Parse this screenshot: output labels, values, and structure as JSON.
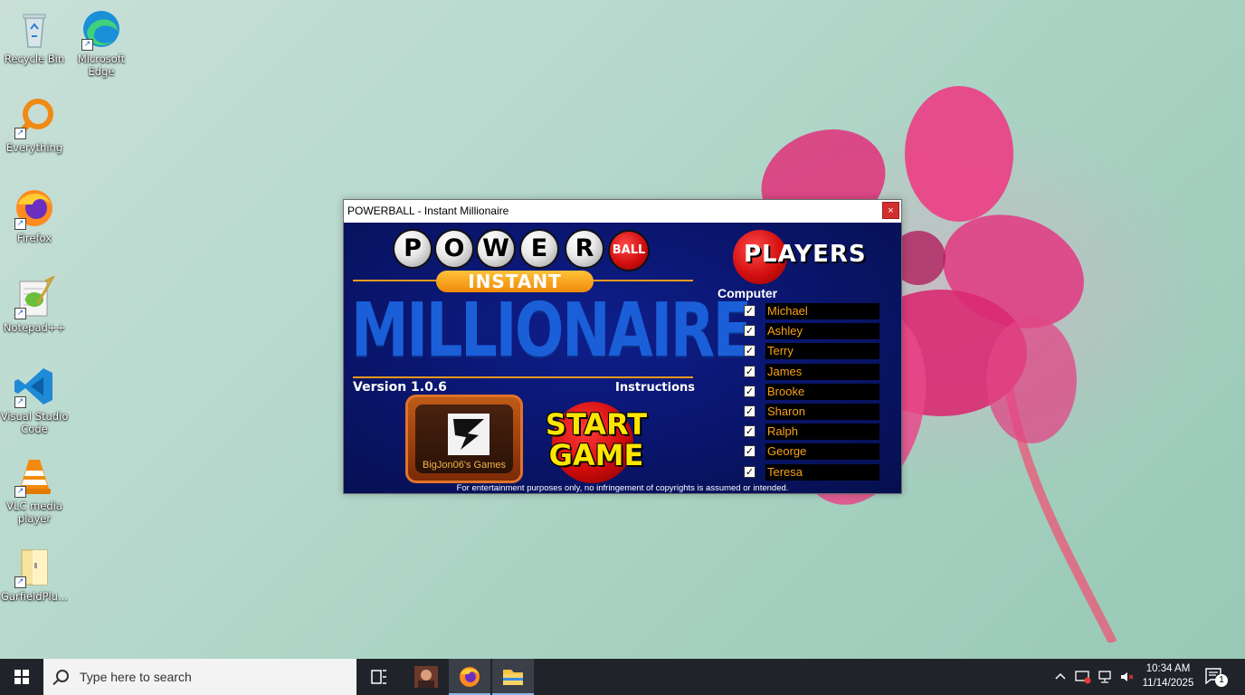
{
  "desktop": {
    "icons": [
      {
        "label": "Recycle Bin",
        "icon": "recycle-bin-icon"
      },
      {
        "label": "Microsoft Edge",
        "icon": "edge-icon"
      },
      {
        "label": "Everything",
        "icon": "everything-search-icon"
      },
      {
        "label": "Firefox",
        "icon": "firefox-icon"
      },
      {
        "label": "Notepad++",
        "icon": "notepad-plus-plus-icon"
      },
      {
        "label": "Visual Studio Code",
        "icon": "vscode-icon"
      },
      {
        "label": "VLC media player",
        "icon": "vlc-icon"
      },
      {
        "label": "GarfieldPlu...",
        "icon": "folder-icon"
      }
    ]
  },
  "window": {
    "title": "POWERBALL - Instant Millionaire",
    "close_label": "×"
  },
  "game": {
    "power_letters": [
      "P",
      "O",
      "W",
      "E",
      "R"
    ],
    "ball_label": "BALL",
    "instant_label": "INSTANT",
    "millionaire_label": "MILLIONAIRE",
    "version": "Version 1.0.6",
    "instructions_label": "Instructions",
    "logo_caption": "BigJon06's Games",
    "start_line1": "START",
    "start_line2": "GAME",
    "players_label": "PLAYERS",
    "computer_label": "Computer",
    "players": [
      {
        "name": "Michael",
        "checked": true
      },
      {
        "name": "Ashley",
        "checked": true
      },
      {
        "name": "Terry",
        "checked": true
      },
      {
        "name": "James",
        "checked": true
      },
      {
        "name": "Brooke",
        "checked": true
      },
      {
        "name": "Sharon",
        "checked": true
      },
      {
        "name": "Ralph",
        "checked": true
      },
      {
        "name": "George",
        "checked": true
      },
      {
        "name": "Teresa",
        "checked": true
      }
    ],
    "disclaimer": "For entertainment purposes only, no infringement of copyrights is assumed or intended.",
    "colors": {
      "accent_orange": "#f39a1e",
      "player_name": "#f7a21b",
      "start_yellow": "#ffe600"
    }
  },
  "taskbar": {
    "search_placeholder": "Type here to search",
    "time": "10:34 AM",
    "date": "11/14/2025",
    "notification_count": "1"
  }
}
